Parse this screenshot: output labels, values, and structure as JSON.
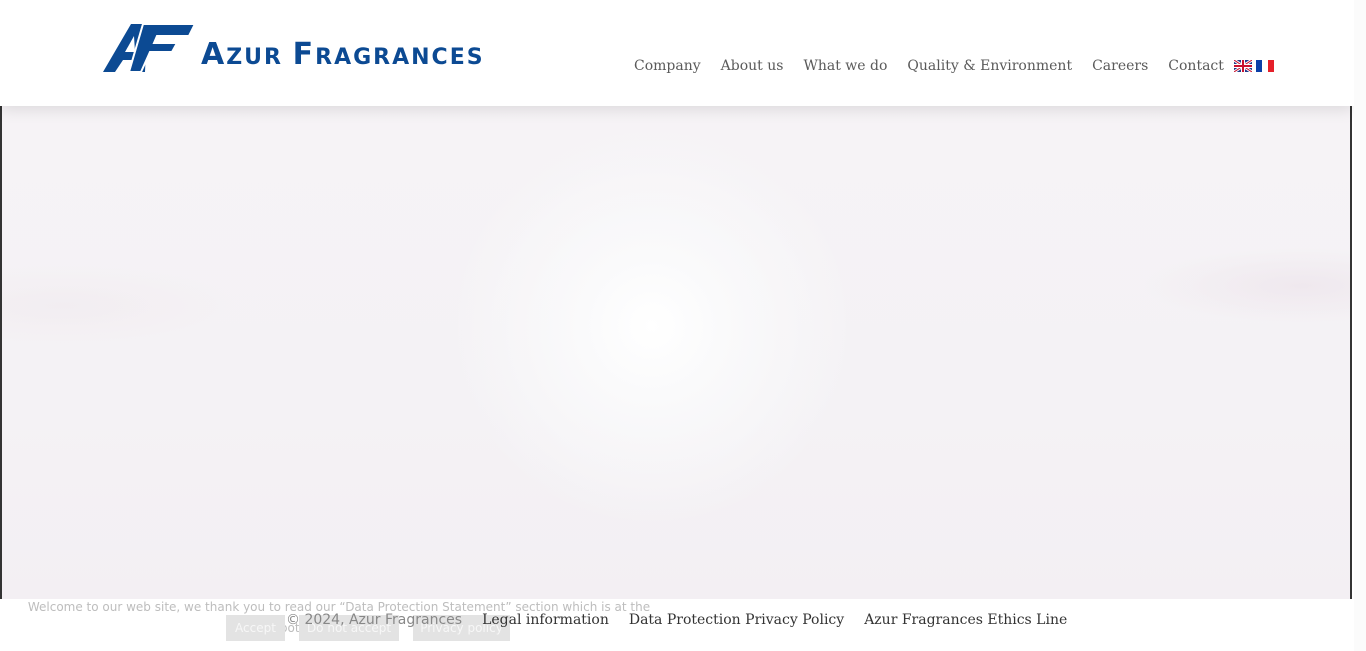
{
  "brand": {
    "name": "Azur Fragrances",
    "monogram": "AF",
    "color": "#0c4a93"
  },
  "nav": {
    "items": [
      "Company",
      "About us",
      "What we do",
      "Quality & Environment",
      "Careers",
      "Contact"
    ],
    "languages": [
      "uk-flag-icon",
      "fr-flag-icon"
    ]
  },
  "cookie": {
    "message": "Welcome to our web site, we thank you to read our “Data Protection Statement” section which is at the bottom of this page",
    "accept": "Accept",
    "decline": "Do not accept",
    "privacy": "Privacy policy"
  },
  "footer": {
    "copyright": "© 2024, Azur Fragrances",
    "links": [
      "Legal information",
      "Data Protection Privacy Policy",
      "Azur Fragrances Ethics Line"
    ]
  }
}
